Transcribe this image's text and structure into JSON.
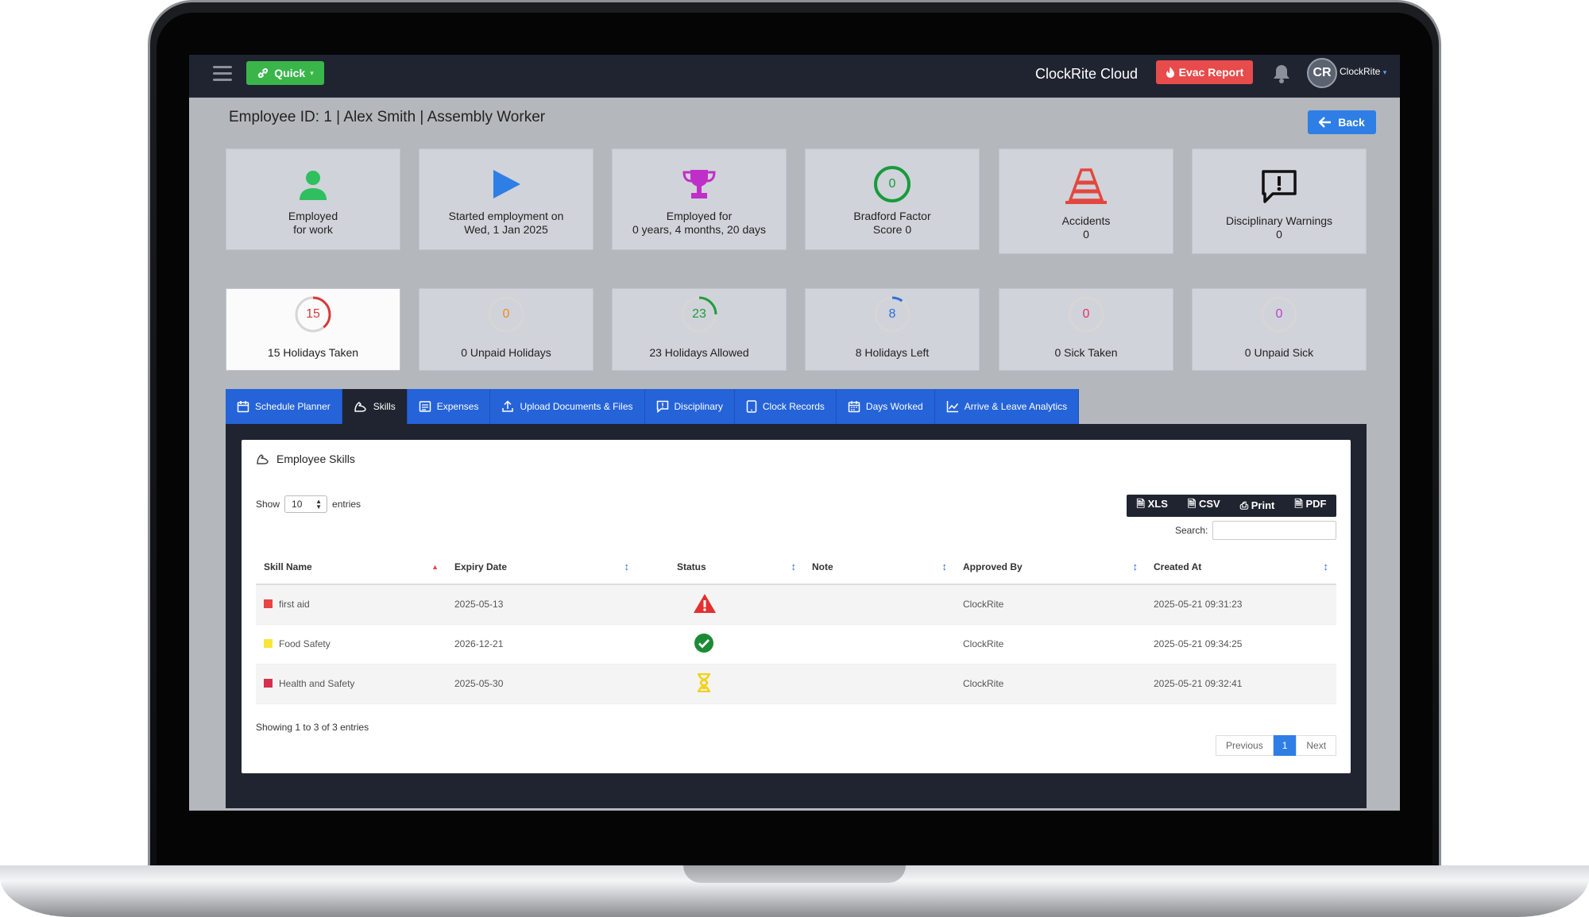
{
  "topbar": {
    "quick_label": "Quick",
    "brand": "ClockRite Cloud",
    "evac_label": "Evac Report",
    "avatar_initials": "CR",
    "user_name": "ClockRite"
  },
  "page": {
    "heading": "Employee ID: 1 | Alex Smith | Assembly Worker",
    "back_label": "Back"
  },
  "info_cards": [
    {
      "line1": "Employed",
      "line2": "for work",
      "icon": "person-icon",
      "color": "#2fbf5e"
    },
    {
      "line1": "Started employment on",
      "line2": "Wed, 1 Jan 2025",
      "icon": "play-icon",
      "color": "#2e7ee6"
    },
    {
      "line1": "Employed for",
      "line2": "0 years, 4 months, 20 days",
      "icon": "trophy-icon",
      "color": "#c02ec9"
    },
    {
      "line1": "Bradford Factor",
      "line2": "Score 0",
      "icon": "bradford-ring",
      "value": "0",
      "color": "#179b3d"
    },
    {
      "line1": "Accidents",
      "line2": "0",
      "icon": "traffic-cone-icon",
      "color": "#e2473f"
    },
    {
      "line1": "Disciplinary Warnings",
      "line2": "0",
      "icon": "warning-message-icon",
      "color": "#111111"
    }
  ],
  "holiday_cards": [
    {
      "value": "15",
      "label": "15 Holidays Taken",
      "color": "#d93a3a",
      "fraction": 0.39
    },
    {
      "value": "0",
      "label": "0 Unpaid Holidays",
      "color": "#f08a24",
      "fraction": 0
    },
    {
      "value": "23",
      "label": "23 Holidays Allowed",
      "color": "#1f9d3a",
      "fraction": 0.25
    },
    {
      "value": "8",
      "label": "8 Holidays Left",
      "color": "#2e6fd9",
      "fraction": 0.1
    },
    {
      "value": "0",
      "label": "0 Sick Taken",
      "color": "#e0336b",
      "fraction": 0
    },
    {
      "value": "0",
      "label": "0 Unpaid Sick",
      "color": "#c23fd1",
      "fraction": 0
    }
  ],
  "tabs": [
    {
      "label": "Schedule Planner",
      "icon": "calendar-icon"
    },
    {
      "label": "Skills",
      "icon": "muscle-icon",
      "active": true
    },
    {
      "label": "Expenses",
      "icon": "receipt-icon"
    },
    {
      "label": "Upload Documents & Files",
      "icon": "upload-icon"
    },
    {
      "label": "Disciplinary",
      "icon": "message-alert-icon"
    },
    {
      "label": "Clock Records",
      "icon": "tablet-icon"
    },
    {
      "label": "Days Worked",
      "icon": "calendar-grid-icon"
    },
    {
      "label": "Arrive & Leave Analytics",
      "icon": "chart-line-icon"
    }
  ],
  "skills": {
    "title": "Employee Skills",
    "show_label": "Show",
    "entries_value": "10",
    "entries_label": "entries",
    "export": [
      "XLS",
      "CSV",
      "Print",
      "PDF"
    ],
    "search_label": "Search:",
    "columns": [
      "Skill Name",
      "Expiry Date",
      "Status",
      "Note",
      "Approved By",
      "Created At"
    ],
    "rows": [
      {
        "color": "#e84545",
        "name": "first aid",
        "expiry": "2025-05-13",
        "status": "expired-warning-icon",
        "note": "",
        "approved_by": "ClockRite",
        "created_at": "2025-05-21 09:31:23"
      },
      {
        "color": "#f7e63a",
        "name": "Food Safety",
        "expiry": "2026-12-21",
        "status": "valid-check-icon",
        "note": "",
        "approved_by": "ClockRite",
        "created_at": "2025-05-21 09:34:25"
      },
      {
        "color": "#d6304f",
        "name": "Health and Safety",
        "expiry": "2025-05-30",
        "status": "pending-hourglass-icon",
        "note": "",
        "approved_by": "ClockRite",
        "created_at": "2025-05-21 09:32:41"
      }
    ],
    "showing_text": "Showing 1 to 3 of 3 entries",
    "pager": {
      "previous": "Previous",
      "current": "1",
      "next": "Next"
    }
  }
}
